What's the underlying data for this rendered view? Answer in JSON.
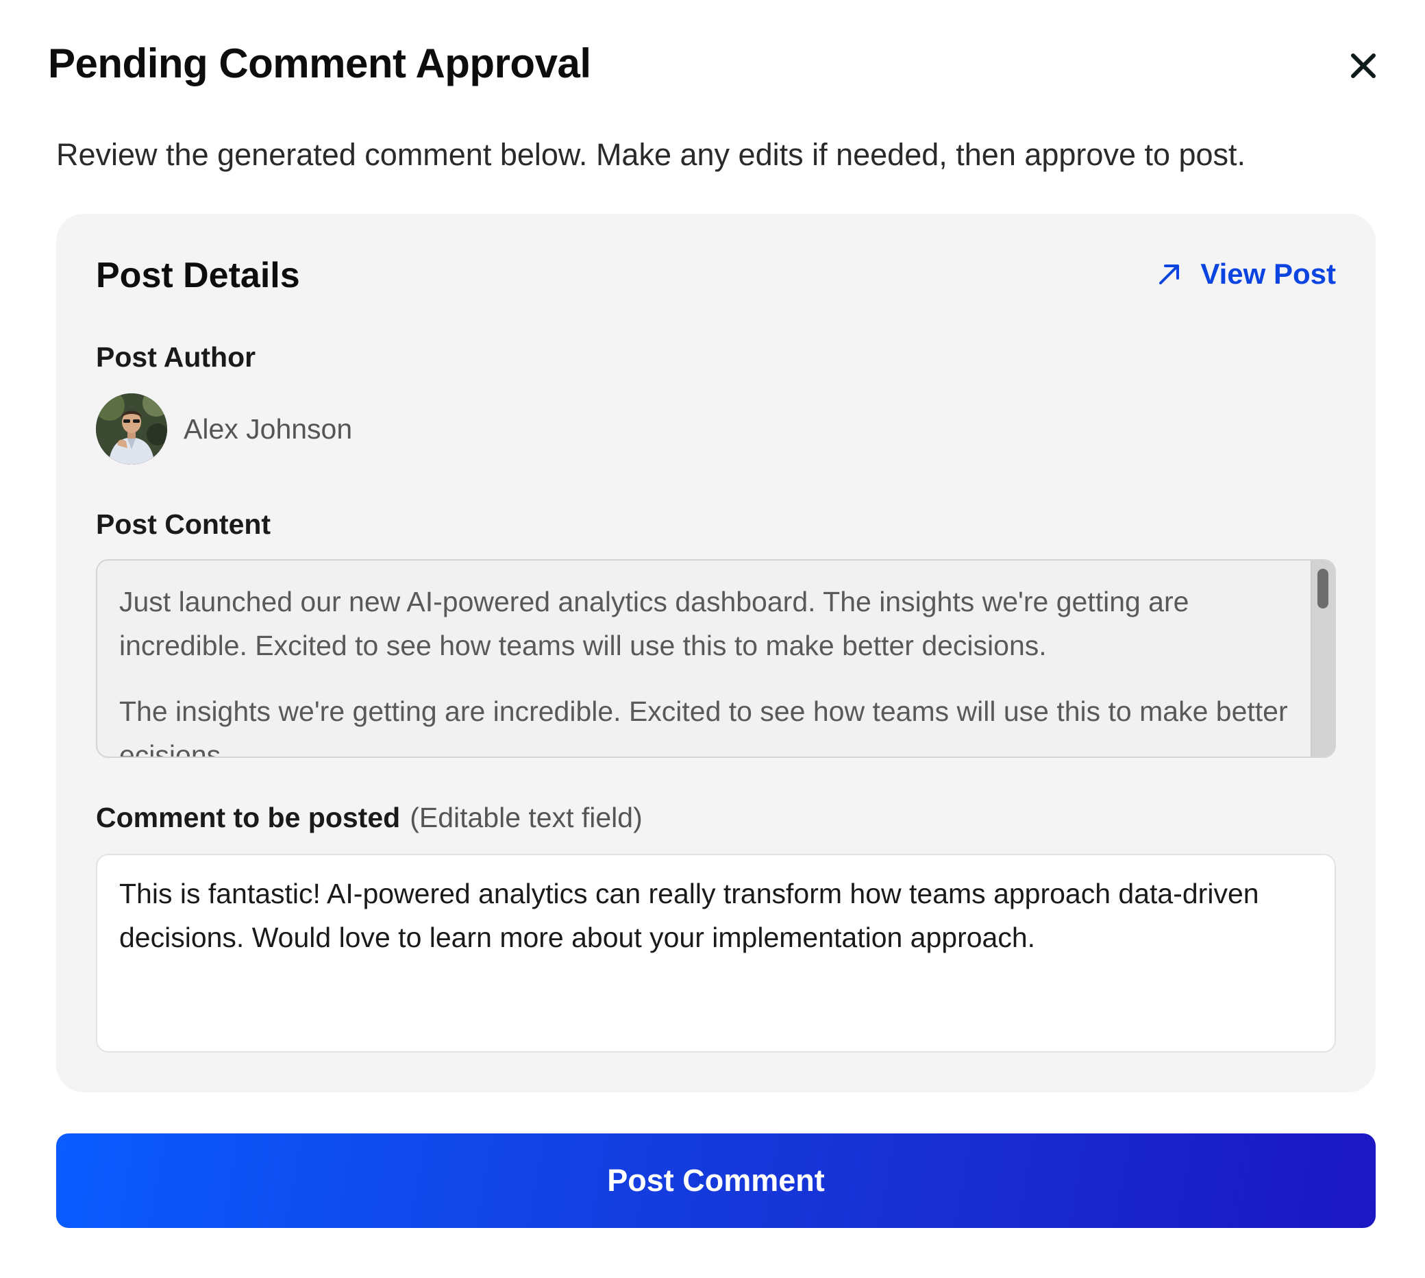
{
  "dialog": {
    "title": "Pending Comment Approval",
    "subtitle": "Review the generated comment below. Make any edits if needed, then approve to post.",
    "close_icon": "close-icon"
  },
  "post_details": {
    "heading": "Post Details",
    "view_post_label": "View Post",
    "view_post_icon": "arrow-up-right-icon",
    "author_label": "Post Author",
    "author_name": "Alex Johnson",
    "content_label": "Post Content",
    "content_paragraphs": [
      "Just launched our new AI-powered analytics dashboard. The insights we're getting are incredible. Excited to see how teams will use this to make better decisions.",
      "The insights we're getting are incredible. Excited to see how teams will use this to make better ecisions"
    ],
    "comment_label": "Comment to be posted",
    "comment_hint": "(Editable text field)",
    "comment_value": "This is fantastic! AI-powered analytics can really transform how teams approach data-driven decisions. Would love to learn more about your implementation approach."
  },
  "actions": {
    "post_comment_label": "Post Comment"
  },
  "colors": {
    "accent": "#0b44e0",
    "button_gradient_start": "#0a5cff",
    "button_gradient_end": "#1c17c4",
    "card_background": "#f4f4f4"
  }
}
